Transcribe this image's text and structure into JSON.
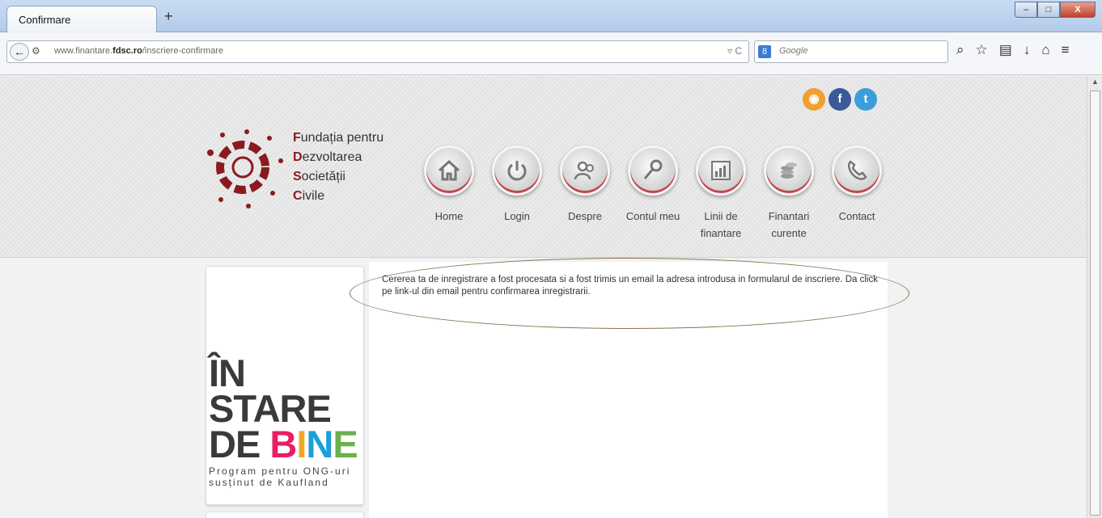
{
  "browser": {
    "tab_title": "Confirmare",
    "new_tab": "+",
    "url_prefix": "www.finantare.",
    "url_domain": "fdsc.ro",
    "url_path": "/inscriere-confirmare",
    "search_placeholder": "Google",
    "window_buttons": [
      "–",
      "□",
      "X"
    ]
  },
  "logo": {
    "lines": [
      {
        "initial": "F",
        "rest": "undația pentru"
      },
      {
        "initial": "D",
        "rest": "ezvoltarea"
      },
      {
        "initial": "S",
        "rest": "ocietății"
      },
      {
        "initial": "C",
        "rest": "ivile"
      }
    ]
  },
  "social": [
    {
      "icon": "rss-icon",
      "glyph": "◉",
      "color": "#f0a030"
    },
    {
      "icon": "facebook-icon",
      "glyph": "f",
      "color": "#3b5998"
    },
    {
      "icon": "twitter-icon",
      "glyph": "t",
      "color": "#3a9fd8"
    }
  ],
  "nav": {
    "items": [
      {
        "label": "Home",
        "icon": "home-icon"
      },
      {
        "label": "Login",
        "icon": "power-icon"
      },
      {
        "label": "Despre",
        "icon": "people-icon"
      },
      {
        "label": "Contul meu",
        "icon": "key-icon"
      },
      {
        "label": "Linii de finantare",
        "icon": "chart-icon"
      },
      {
        "label": "Finantari curente",
        "icon": "coins-icon"
      },
      {
        "label": "Contact",
        "icon": "phone-icon"
      }
    ]
  },
  "sidebar": {
    "banner_line1": "ÎN STARE",
    "banner_de": "DE ",
    "banner_bine": [
      "B",
      "I",
      "N",
      "E"
    ],
    "banner_bine_colors": [
      "#e91e63",
      "#f5a623",
      "#1ba0d8",
      "#6ab04c"
    ],
    "banner_sub1": "Program pentru ONG-uri",
    "banner_sub2": "susținut de Kaufland"
  },
  "content": {
    "message": "Cererea ta de inregistrare a fost procesata si a fost trimis un email la adresa introdusa in formularul de inscriere. Da click pe link-ul din email pentru confirmarea inregistrarii."
  }
}
